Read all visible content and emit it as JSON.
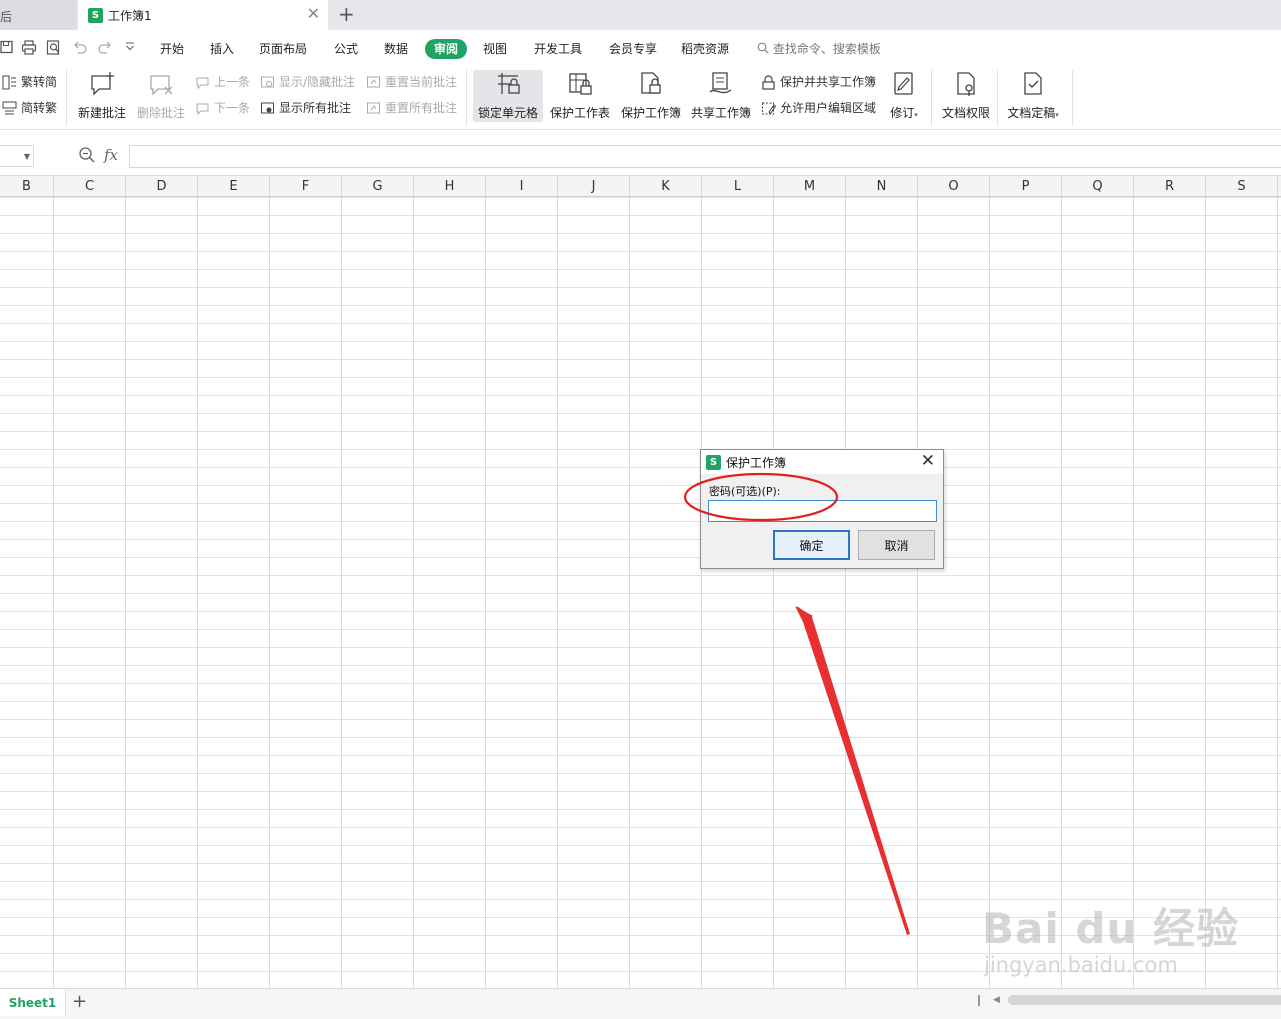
{
  "window": {
    "prev_tab_fragment": "后",
    "active_tab_title": "工作簿1",
    "app_badge": "S",
    "close_glyph": "✕",
    "add_glyph": "+"
  },
  "menu": {
    "items": [
      "开始",
      "插入",
      "页面布局",
      "公式",
      "数据",
      "审阅",
      "视图",
      "开发工具",
      "会员专享",
      "稻壳资源"
    ],
    "active": "审阅",
    "search_placeholder": "查找命令、搜索模板"
  },
  "ribbon": {
    "fan_to_simp": "繁转简",
    "simp_to_fan": "简转繁",
    "new_comment": "新建批注",
    "delete_comment": "删除批注",
    "prev_comment": "上一条",
    "next_comment": "下一条",
    "show_hide_comment": "显示/隐藏批注",
    "show_all_comments": "显示所有批注",
    "reset_current_comment": "重置当前批注",
    "reset_all_comments": "重置所有批注",
    "lock_cell": "锁定单元格",
    "protect_sheet": "保护工作表",
    "protect_workbook": "保护工作簿",
    "share_workbook": "共享工作簿",
    "protect_and_share": "保护并共享工作簿",
    "allow_edit_ranges": "允许用户编辑区域",
    "track_changes": "修订",
    "doc_permission": "文档权限",
    "doc_finalize": "文档定稿"
  },
  "formula_bar": {
    "fx_label": "fx",
    "value": ""
  },
  "columns": [
    "B",
    "C",
    "D",
    "E",
    "F",
    "G",
    "H",
    "I",
    "J",
    "K",
    "L",
    "M",
    "N",
    "O",
    "P",
    "Q",
    "R",
    "S"
  ],
  "sheets": {
    "active": "Sheet1",
    "add_glyph": "+"
  },
  "dialog": {
    "title": "保护工作簿",
    "badge": "S",
    "close_glyph": "✕",
    "password_label": "密码(可选)(P):",
    "password_value": "",
    "ok_label": "确定",
    "cancel_label": "取消"
  },
  "annotation": {
    "ellipse_color": "#e02020",
    "arrow_color": "#e83030"
  },
  "watermark": {
    "brand": "Bai du 经验",
    "url": "jingyan.baidu.com"
  },
  "colors": {
    "accent": "#1fa463",
    "dialog_focus": "#2a74c9"
  }
}
